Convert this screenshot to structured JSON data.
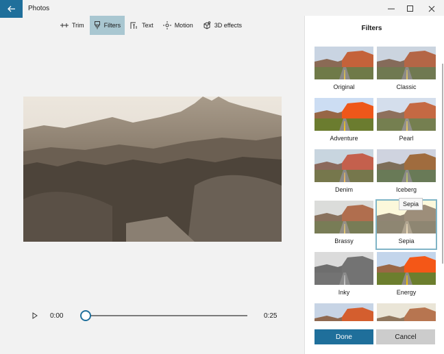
{
  "window": {
    "title": "Photos",
    "back_icon": "arrow-left-icon",
    "controls": [
      "minimize-icon",
      "maximize-icon",
      "close-icon"
    ]
  },
  "toolbar": {
    "tools": [
      {
        "label": "Trim",
        "icon": "trim-icon",
        "active": false
      },
      {
        "label": "Filters",
        "icon": "filters-icon",
        "active": true
      },
      {
        "label": "Text",
        "icon": "text-icon",
        "active": false
      },
      {
        "label": "Motion",
        "icon": "motion-icon",
        "active": false
      },
      {
        "label": "3D effects",
        "icon": "3d-effects-icon",
        "active": false
      }
    ]
  },
  "player": {
    "time_current": "0:00",
    "time_total": "0:25",
    "progress": 0
  },
  "filters_panel": {
    "title": "Filters",
    "items": [
      {
        "label": "Original"
      },
      {
        "label": "Classic"
      },
      {
        "label": "Adventure"
      },
      {
        "label": "Pearl"
      },
      {
        "label": "Denim"
      },
      {
        "label": "Iceberg"
      },
      {
        "label": "Brassy"
      },
      {
        "label": "Sepia",
        "selected": true
      },
      {
        "label": "Inky"
      },
      {
        "label": "Energy"
      },
      {
        "label": ""
      },
      {
        "label": ""
      }
    ],
    "tooltip": "Sepia",
    "done_label": "Done",
    "cancel_label": "Cancel"
  },
  "colors": {
    "accent": "#1f6f9b",
    "active_tool_bg": "#a9c7d1",
    "selected_outline": "#7fb4c6"
  }
}
